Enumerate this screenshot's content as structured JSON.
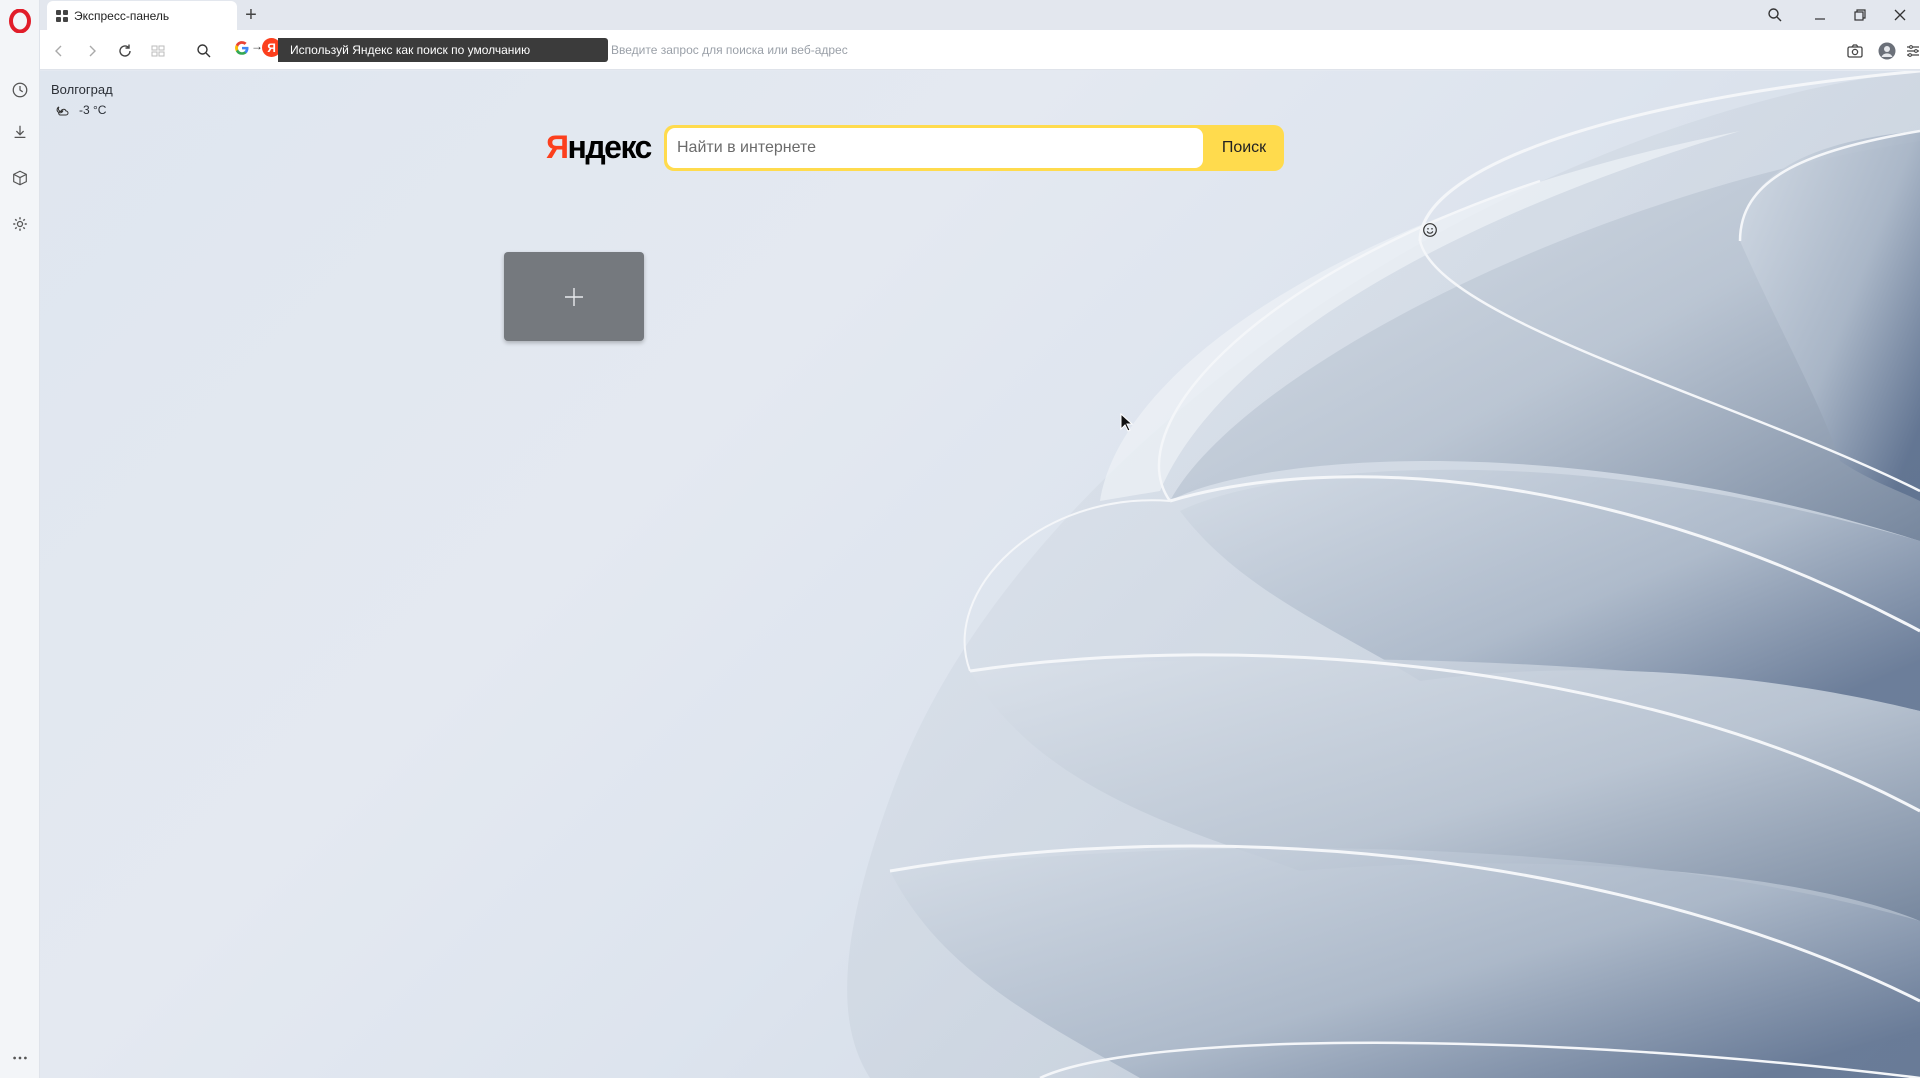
{
  "tab": {
    "title": "Экспресс-панель",
    "icon": "speed-dial-grid-icon"
  },
  "new_tab": {
    "label": "+"
  },
  "addressbar": {
    "promo_text": "Используй Яндекс как поиск по умолчанию",
    "placeholder": "Введите запрос для поиска или веб-адрес",
    "value": ""
  },
  "weather": {
    "city": "Волгоград",
    "temperature": "-3 °C",
    "icon": "cloud-moon-icon"
  },
  "yandex": {
    "logo_first": "Я",
    "logo_rest": "ндекс",
    "search_placeholder": "Найти в интернете",
    "search_button": "Поиск"
  },
  "colors": {
    "yandex_red": "#fc3f1d",
    "yandex_yellow": "#ffdb4d",
    "opera_red": "#e11d2a",
    "tile_gray": "#75797e"
  }
}
